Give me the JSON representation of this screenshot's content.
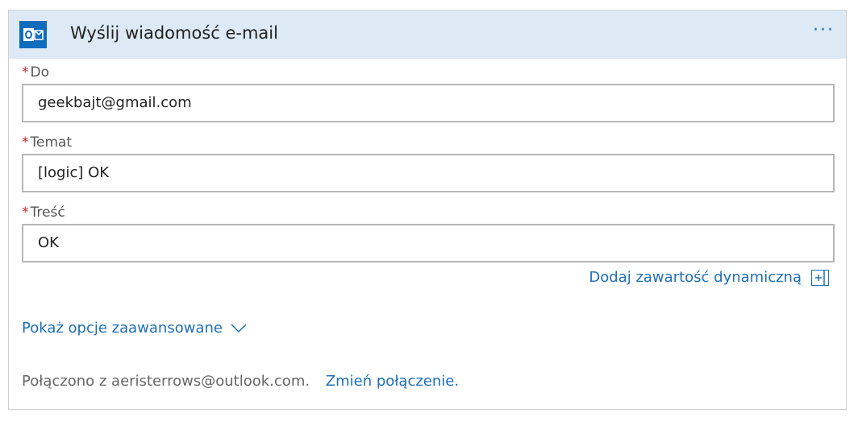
{
  "action": {
    "title": "Wyślij wiadomość e-mail",
    "icon": "outlook-icon",
    "more_label": "···",
    "more_icon": "ellipsis-icon"
  },
  "fields": [
    {
      "required_mark": "*",
      "label": "Do",
      "value": "geekbajt@gmail.com"
    },
    {
      "required_mark": "*",
      "label": "Temat",
      "value": "[logic] OK"
    },
    {
      "required_mark": "*",
      "label": "Treść",
      "value": "OK"
    }
  ],
  "dynamic_content": {
    "label": "Dodaj zawartość dynamiczną",
    "icon": "add-box-icon"
  },
  "advanced": {
    "label": "Pokaż opcje zaawansowane",
    "icon": "chevron-down-icon"
  },
  "connection": {
    "text": "Połączono z aeristerrows@outlook.com.",
    "change_label": "Zmień połączenie."
  },
  "colors": {
    "header_bg": "#ddeaf5",
    "accent": "#1e6fb8",
    "outlook_blue": "#0f6cbd",
    "required": "#c4262e"
  }
}
